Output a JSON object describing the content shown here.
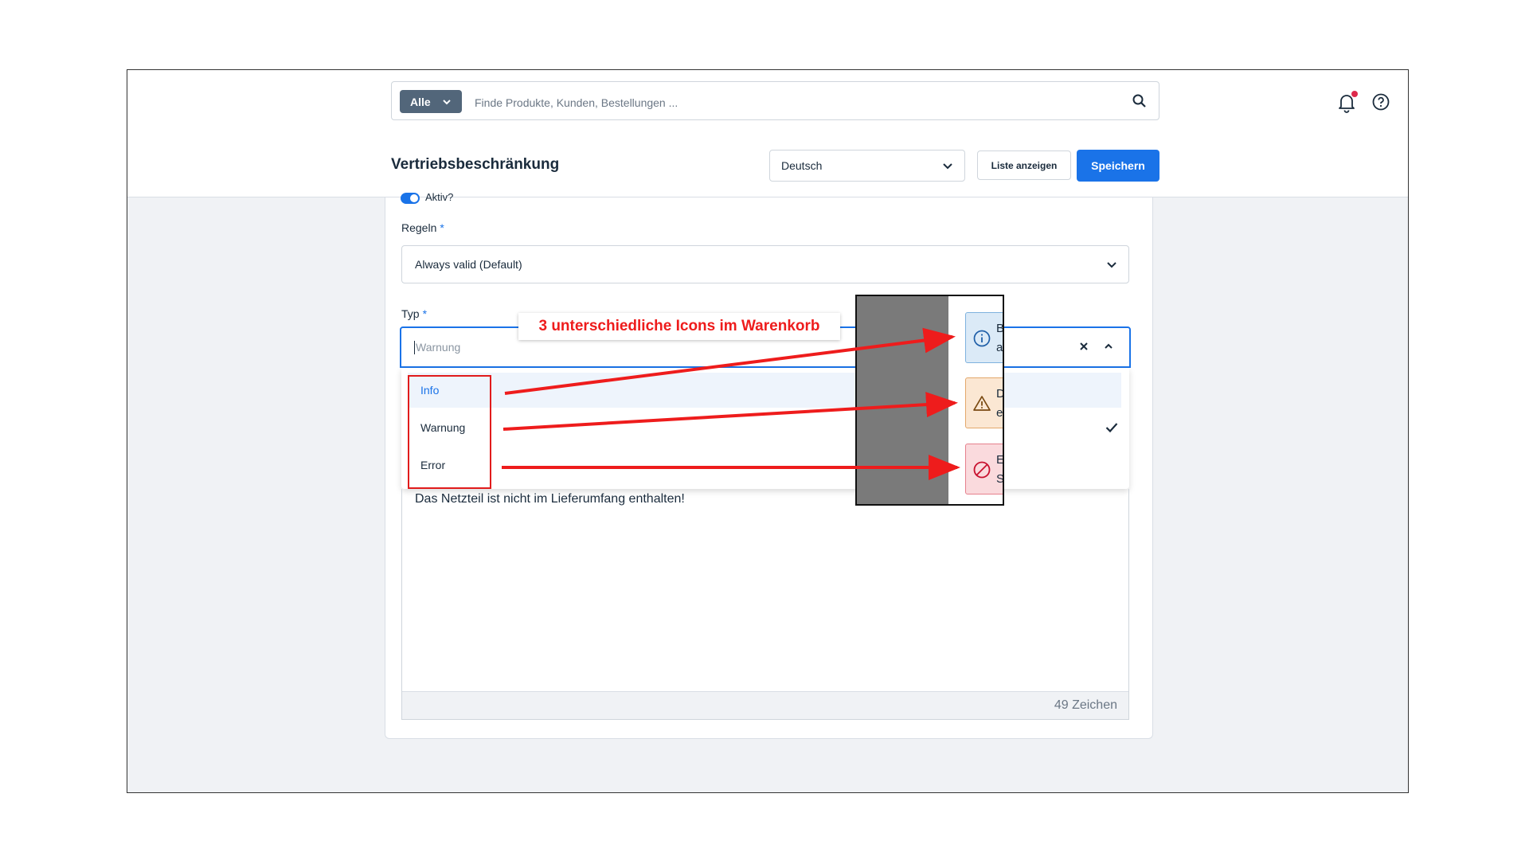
{
  "search": {
    "scope_label": "Alle",
    "placeholder": "Finde Produkte, Kunden, Bestellungen ..."
  },
  "header": {
    "title": "Vertriebsbeschränkung",
    "language": "Deutsch",
    "list_button": "Liste anzeigen",
    "save_button": "Speichern"
  },
  "form": {
    "active_label": "Aktiv?",
    "rules_label": "Regeln",
    "required_mark": "*",
    "rules_value": "Always valid (Default)",
    "type_label": "Typ",
    "type_value": "Warnung",
    "type_options": [
      "Info",
      "Warnung",
      "Error"
    ],
    "message_text": "Das Netzteil ist nicht im Lieferumfang enthalten!",
    "char_count": "49 Zeichen"
  },
  "annotation": {
    "callout": "3 unterschiedliche Icons im Warenkorb",
    "inset_letters": [
      [
        "B",
        "a"
      ],
      [
        "D",
        "e"
      ],
      [
        "E",
        "S"
      ]
    ]
  },
  "colors": {
    "primary": "#1a73e8",
    "annotation_red": "#e11b1b",
    "info_bg": "#dbeaf7",
    "warning_bg": "#fbe7d3",
    "error_bg": "#fadadd"
  }
}
